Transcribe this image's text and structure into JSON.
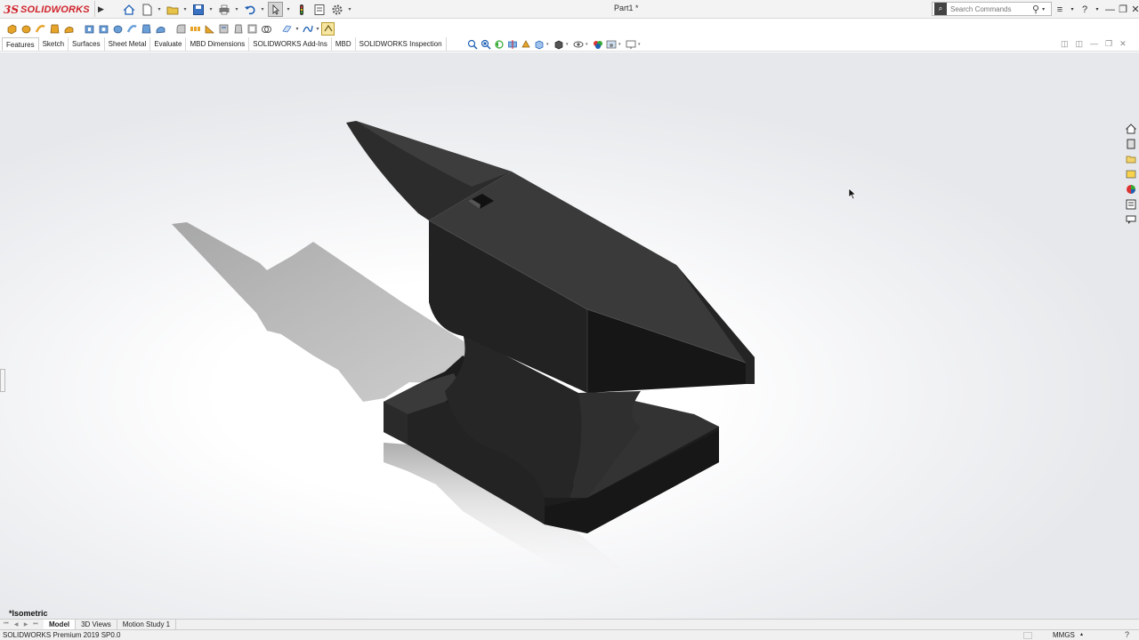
{
  "app": {
    "logo_prefix": "3S",
    "logo_name": "SOLIDWORKS",
    "document_title": "Part1 *"
  },
  "title_bar": {
    "search_placeholder": "Search Commands",
    "search_icon": "magnifier-icon",
    "controls": [
      "≡",
      "?",
      "—",
      "❐",
      "✕"
    ]
  },
  "command_tabs": [
    "Features",
    "Sketch",
    "Surfaces",
    "Sheet Metal",
    "Evaluate",
    "MBD Dimensions",
    "SOLIDWORKS Add-Ins",
    "MBD",
    "SOLIDWORKS Inspection"
  ],
  "active_command_tab": "Features",
  "graphics": {
    "view_orientation": "*Isometric",
    "model": "anvil"
  },
  "bottom_tabs": [
    "Model",
    "3D Views",
    "Motion Study 1"
  ],
  "active_bottom_tab": "Model",
  "status_bar": {
    "version": "SOLIDWORKS Premium 2019 SP0.0",
    "units": "MMGS"
  },
  "colors": {
    "brand": "#d0232b",
    "model": "#2b2b2b",
    "accent": "#1e6bd6"
  }
}
